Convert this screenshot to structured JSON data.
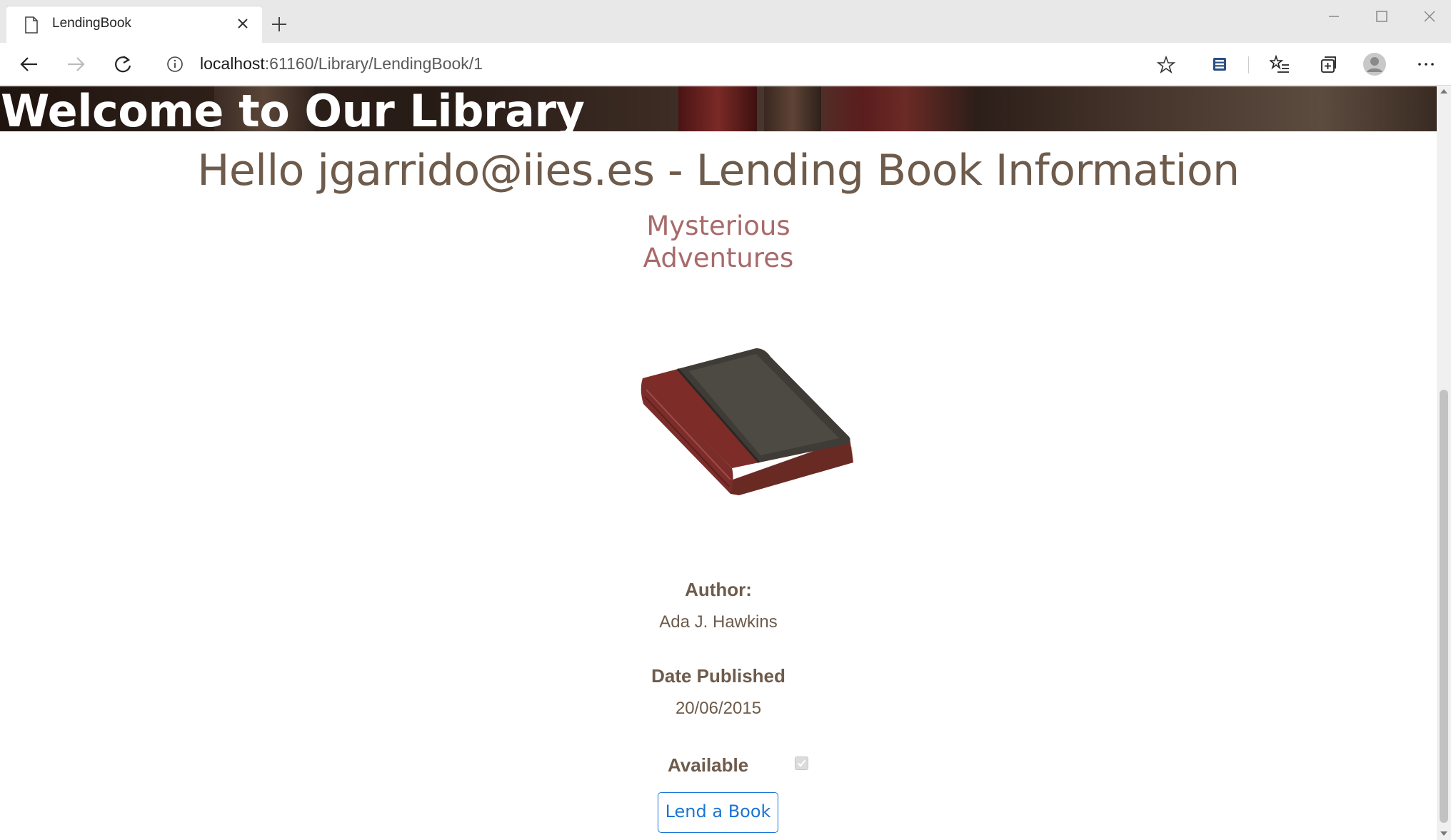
{
  "browser": {
    "tab_title": "LendingBook",
    "url_host": "localhost",
    "url_rest": ":61160/Library/LendingBook/1"
  },
  "banner": {
    "welcome": "Welcome to Our Library"
  },
  "page": {
    "heading": "Hello jgarrido@iies.es - Lending Book Information",
    "book_title": "Mysterious Adventures",
    "author_label": "Author:",
    "author_value": "Ada J. Hawkins",
    "date_label": "Date Published",
    "date_value": "20/06/2015",
    "available_label": "Available",
    "available_checked": true,
    "lend_button": "Lend a Book"
  },
  "icons": {
    "tab": "page-icon",
    "close_tab": "close-icon",
    "new_tab": "plus-icon",
    "back": "back-arrow-icon",
    "forward": "forward-arrow-icon",
    "reload": "reload-icon",
    "site_info": "info-icon",
    "favorite": "star-icon",
    "extension": "extension-icon",
    "favorites": "favorites-list-icon",
    "collections": "collections-icon",
    "profile": "avatar-icon",
    "menu": "more-icon"
  },
  "colors": {
    "heading": "#6e5b4b",
    "book_title": "#a86a6a",
    "link_blue": "#1b74d6"
  }
}
